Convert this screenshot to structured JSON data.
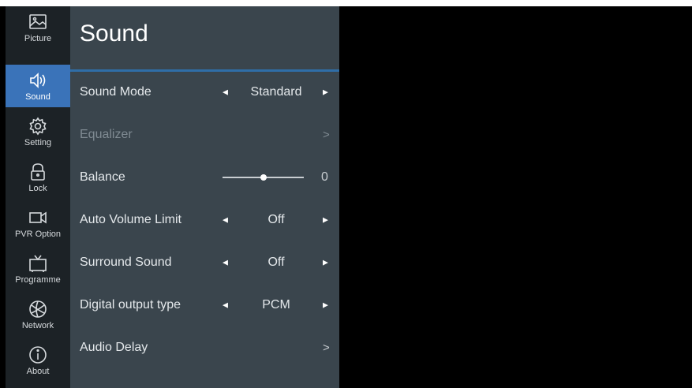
{
  "sidebar": {
    "items": [
      {
        "label": "Picture",
        "icon": "picture-icon"
      },
      {
        "label": "Sound",
        "icon": "speaker-icon",
        "active": true
      },
      {
        "label": "Setting",
        "icon": "gear-icon"
      },
      {
        "label": "Lock",
        "icon": "lock-icon"
      },
      {
        "label": "PVR Option",
        "icon": "camera-icon"
      },
      {
        "label": "Programme",
        "icon": "tv-icon"
      },
      {
        "label": "Network",
        "icon": "globe-icon"
      },
      {
        "label": "About",
        "icon": "info-icon"
      }
    ]
  },
  "panel": {
    "title": "Sound",
    "rows": [
      {
        "label": "Sound Mode",
        "value": "Standard"
      },
      {
        "label": "Equalizer",
        "disabled": true
      },
      {
        "label": "Balance",
        "value": "0",
        "slider_fraction": 0.5
      },
      {
        "label": "Auto Volume Limit",
        "value": "Off"
      },
      {
        "label": "Surround Sound",
        "value": "Off"
      },
      {
        "label": "Digital output type",
        "value": "PCM"
      },
      {
        "label": "Audio Delay"
      }
    ]
  },
  "colors": {
    "accent": "#3a73b9",
    "panel_bg": "#3a454d",
    "sidebar_bg": "#1c2226",
    "screen_bg": "#000000"
  }
}
